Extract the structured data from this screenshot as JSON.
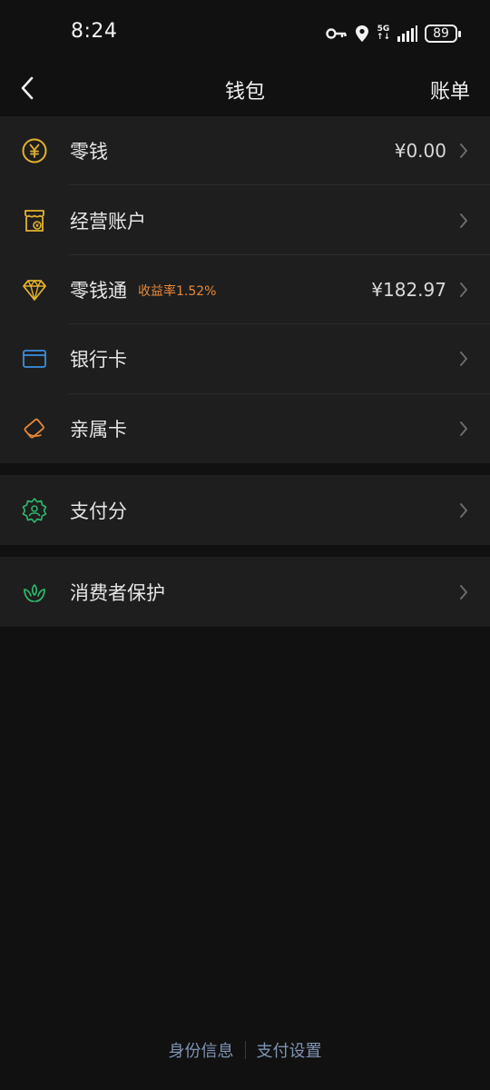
{
  "status_bar": {
    "time": "8:24",
    "network_top": "5G",
    "network_bottom": "↑↓",
    "battery": "89",
    "icons": [
      "key-icon",
      "location-icon",
      "signal-icon",
      "battery-icon"
    ]
  },
  "nav": {
    "title": "钱包",
    "right_action": "账单",
    "back_icon": "chevron-left-icon"
  },
  "colors": {
    "background": "#111111",
    "row_background": "#1e1e1e",
    "gold": "#e3b22f",
    "blue": "#3d8fe0",
    "orange": "#e8893a",
    "green": "#2fb36a",
    "link": "#7f93b2"
  },
  "wallet_items": [
    {
      "icon": "yuan-coin-icon",
      "label": "零钱",
      "tag": "",
      "value": "¥0.00"
    },
    {
      "icon": "business-account-icon",
      "label": "经营账户",
      "tag": "",
      "value": ""
    },
    {
      "icon": "diamond-icon",
      "label": "零钱通",
      "tag": "收益率1.52%",
      "value": "¥182.97"
    },
    {
      "icon": "bank-card-icon",
      "label": "银行卡",
      "tag": "",
      "value": ""
    },
    {
      "icon": "family-card-icon",
      "label": "亲属卡",
      "tag": "",
      "value": ""
    }
  ],
  "score_item": {
    "icon": "payment-score-icon",
    "label": "支付分"
  },
  "protection_item": {
    "icon": "consumer-protection-icon",
    "label": "消费者保护"
  },
  "footer": {
    "identity": "身份信息",
    "payment_settings": "支付设置"
  }
}
